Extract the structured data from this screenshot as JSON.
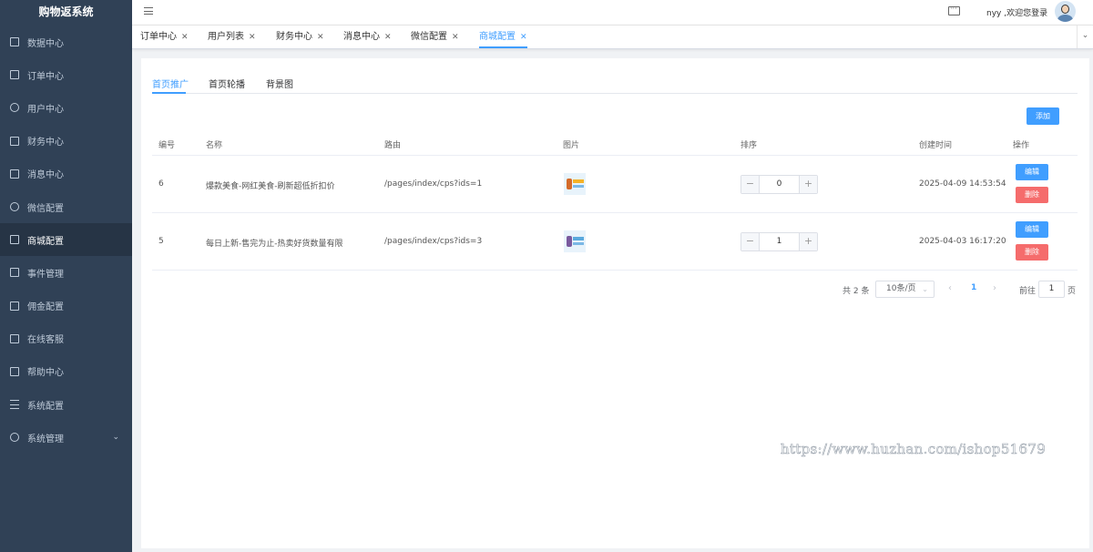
{
  "app": {
    "title": "购物返系统"
  },
  "sidebar": {
    "items": [
      {
        "label": "数据中心",
        "icon": "chart-icon"
      },
      {
        "label": "订单中心",
        "icon": "document-icon"
      },
      {
        "label": "用户中心",
        "icon": "user-icon"
      },
      {
        "label": "财务中心",
        "icon": "wallet-icon"
      },
      {
        "label": "消息中心",
        "icon": "message-icon"
      },
      {
        "label": "微信配置",
        "icon": "wechat-icon"
      },
      {
        "label": "商城配置",
        "icon": "box-icon",
        "active": true
      },
      {
        "label": "事件管理",
        "icon": "list-icon"
      },
      {
        "label": "佣金配置",
        "icon": "document-icon"
      },
      {
        "label": "在线客服",
        "icon": "chat-icon"
      },
      {
        "label": "帮助中心",
        "icon": "monitor-icon"
      },
      {
        "label": "系统配置",
        "icon": "menu-icon"
      },
      {
        "label": "系统管理",
        "icon": "gear-icon",
        "arrow": "chevron-down-icon"
      }
    ]
  },
  "header": {
    "welcome": "nyy ,欢迎您登录"
  },
  "tabs": [
    {
      "label": "订单中心"
    },
    {
      "label": "用户列表"
    },
    {
      "label": "财务中心"
    },
    {
      "label": "消息中心"
    },
    {
      "label": "微信配置"
    },
    {
      "label": "商城配置",
      "active": true
    }
  ],
  "subtabs": [
    "首页推广",
    "首页轮播",
    "背景图"
  ],
  "toolbar": {
    "add_label": "添加"
  },
  "table": {
    "headers": [
      "编号",
      "名称",
      "路由",
      "图片",
      "排序",
      "创建时间",
      "操作"
    ],
    "rows": [
      {
        "id": "6",
        "name": "爆款美食-网红美食-刷新超低折扣价",
        "route": "/pages/index/cps?ids=1",
        "sort": "0",
        "created": "2025-04-09 14:53:54"
      },
      {
        "id": "5",
        "name": "每日上新-售完为止-热卖好货数量有限",
        "route": "/pages/index/cps?ids=3",
        "sort": "1",
        "created": "2025-04-03 16:17:20"
      }
    ],
    "edit_label": "编辑",
    "delete_label": "删除"
  },
  "pagination": {
    "total": "共 2 条",
    "page_size": "10条/页",
    "current_page": "1",
    "goto_label": "前往",
    "goto_value": "1",
    "page_unit": "页"
  },
  "watermark": "https://www.huzhan.com/ishop51679",
  "colors": {
    "accent": "#409eff",
    "danger": "#f56c6c",
    "sidebar": "#304156"
  }
}
